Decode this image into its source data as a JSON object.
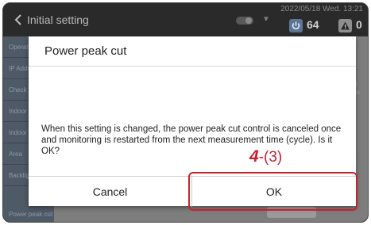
{
  "header": {
    "back_icon": "chevron-left-icon",
    "title": "Initial setting",
    "datetime": "2022/05/18 Wed. 13:21",
    "power_icon": "power-icon",
    "power_count": "64",
    "alert_icon": "warning-icon",
    "alert_count": "0"
  },
  "sidebar": {
    "items": [
      {
        "label": "Operation"
      },
      {
        "label": "IP Address"
      },
      {
        "label": "Check"
      },
      {
        "label": "Indoor"
      },
      {
        "label": "Indoor"
      },
      {
        "label": "Area"
      },
      {
        "label": "Backlight"
      },
      {
        "label": "Power peak cut"
      }
    ]
  },
  "background": {
    "partial_right_line1": "ol",
    "partial_right_line2": "nts"
  },
  "dialog": {
    "title": "Power peak cut",
    "message": "When this setting is changed, the power peak cut control is canceled once and monitoring is restarted from the next measurement time (cycle). Is it OK?",
    "cancel_label": "Cancel",
    "ok_label": "OK"
  },
  "annotation": {
    "step_number": "4",
    "step_sub": "-(3)",
    "color": "#c8212e"
  },
  "colors": {
    "header_bg": "#2a2a2a",
    "sidebar_bg": "#4e5a66",
    "dim_overlay": "#7d7d7d",
    "dialog_bg": "#ffffff",
    "power_badge": "#5a7694"
  }
}
